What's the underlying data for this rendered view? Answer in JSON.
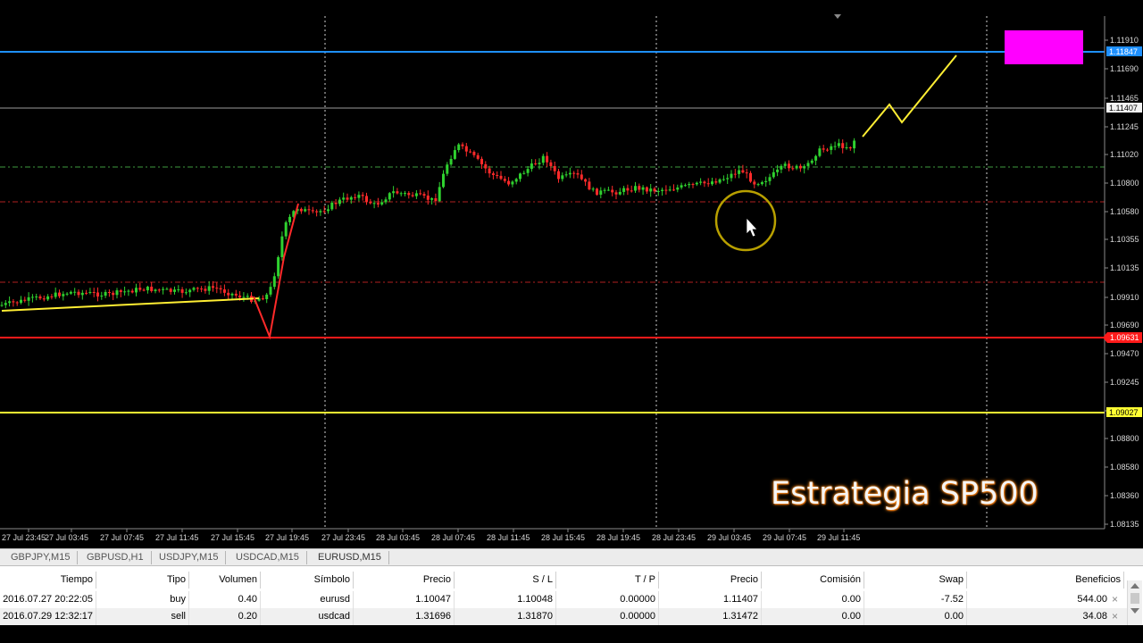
{
  "chart": {
    "symbol": "EURUSD,M15",
    "background": "#000000",
    "price_labels": [
      "1.11910",
      "1.11690",
      "1.11465",
      "1.11245",
      "1.11020",
      "1.10800",
      "1.10580",
      "1.10355",
      "1.10135",
      "1.09910",
      "1.09690",
      "1.09470",
      "1.09245",
      "1.09025",
      "1.08800",
      "1.08580",
      "1.08360",
      "1.08135"
    ],
    "time_labels": [
      "27 Jul 23:45",
      "27 Jul 03:45",
      "27 Jul 07:45",
      "27 Jul 11:45",
      "27 Jul 15:45",
      "27 Jul 19:45",
      "27 Jul 23:45",
      "28 Jul 03:45",
      "28 Jul 07:45",
      "28 Jul 11:45",
      "28 Jul 15:45",
      "28 Jul 19:45",
      "28 Jul 23:45",
      "29 Jul 03:45",
      "29 Jul 07:45",
      "29 Jul 11:45"
    ],
    "tags": {
      "blue_line": "1.11847",
      "current_price": "1.11407",
      "red_line": "1.09631",
      "yellow_line": "1.09027"
    },
    "colors": {
      "blue_line": "#1e90ff",
      "red_line": "#ff1a1a",
      "yellow_line": "#ffff33",
      "magenta_box": "#ff00ff",
      "candle_up": "#2fd12f",
      "candle_down": "#ff2a2a",
      "projection": "#ffee33",
      "cursor_ring": "#b8a000"
    },
    "overlay_text": "Estrategia SP500",
    "icons": [
      "mouse-cursor-icon",
      "scroll-marker-icon"
    ]
  },
  "tabs": [
    "GBPJPY,M15",
    "GBPUSD,H1",
    "USDJPY,M15",
    "USDCAD,M15",
    "EURUSD,M15"
  ],
  "table": {
    "headers": [
      "Tiempo",
      "Tipo",
      "Volumen",
      "Símbolo",
      "Precio",
      "S / L",
      "T / P",
      "Precio",
      "Comisión",
      "Swap",
      "Beneficios"
    ],
    "rows": [
      [
        "2016.07.27 20:22:05",
        "buy",
        "0.40",
        "eurusd",
        "1.10047",
        "1.10048",
        "0.00000",
        "1.11407",
        "0.00",
        "-7.52",
        "544.00"
      ],
      [
        "2016.07.29 12:32:17",
        "sell",
        "0.20",
        "usdcad",
        "1.31696",
        "1.31870",
        "0.00000",
        "1.31472",
        "0.00",
        "0.00",
        "34.08"
      ]
    ]
  }
}
